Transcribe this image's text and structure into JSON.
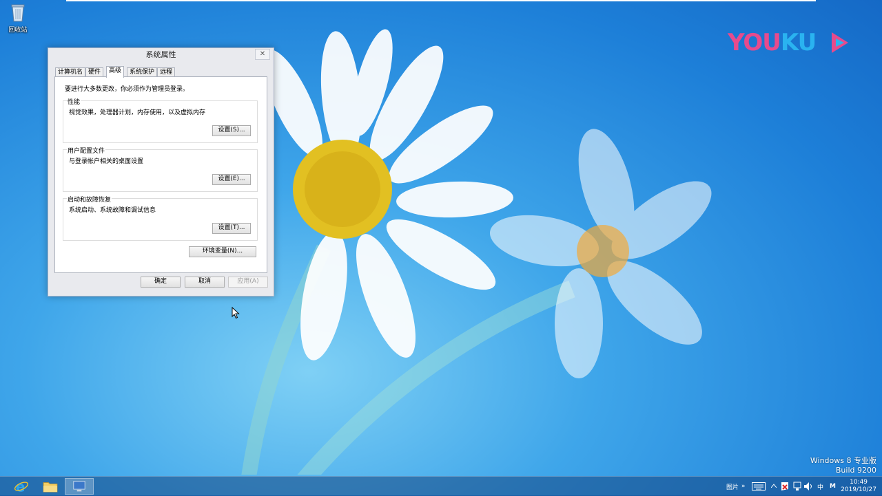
{
  "desktop": {
    "recycle_bin_label": "回收站",
    "watermark": {
      "part1": "YOU",
      "part2": "KU"
    },
    "version_line1": "Windows 8 专业版",
    "version_line2": "Build 9200"
  },
  "dialog": {
    "title": "系统属性",
    "close_glyph": "✕",
    "tabs": [
      {
        "label": "计算机名"
      },
      {
        "label": "硬件"
      },
      {
        "label": "高级"
      },
      {
        "label": "系统保护"
      },
      {
        "label": "远程"
      }
    ],
    "active_tab": "高级",
    "note": "要进行大多数更改，你必须作为管理员登录。",
    "groups": [
      {
        "title": "性能",
        "desc": "视觉效果，处理器计划，内存使用，以及虚拟内存",
        "button": "设置(S)..."
      },
      {
        "title": "用户配置文件",
        "desc": "与登录帐户相关的桌面设置",
        "button": "设置(E)..."
      },
      {
        "title": "启动和故障恢复",
        "desc": "系统启动、系统故障和调试信息",
        "button": "设置(T)..."
      }
    ],
    "env_button": "环境变量(N)...",
    "ok_button": "确定",
    "cancel_button": "取消",
    "apply_button": "应用(A)"
  },
  "taskbar": {
    "tray_label": "图片",
    "tray_chevron": "»",
    "ime_label": "中",
    "ime_mode": "M",
    "time": "10:49",
    "date": "2019/10/27"
  },
  "colors": {
    "youku_pink": "#e64b8d",
    "youku_blue": "#2ab3f0",
    "wallpaper_blue": "#1d7fd8"
  }
}
